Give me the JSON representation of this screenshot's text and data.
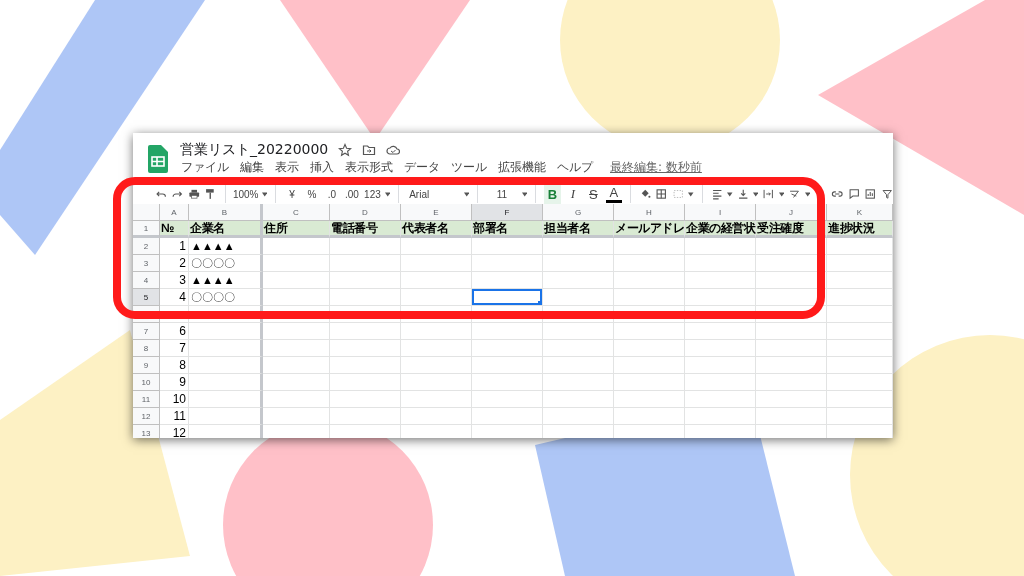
{
  "window": {
    "title": "営業リスト_20220000"
  },
  "menu": [
    "ファイル",
    "編集",
    "表示",
    "挿入",
    "表示形式",
    "データ",
    "ツール",
    "拡張機能",
    "ヘルプ"
  ],
  "last_edit": "最終編集: 数秒前",
  "toolbar": {
    "zoom": "100%",
    "currency": "¥",
    "percent": "%",
    "decrease_decimals": ".0",
    "increase_decimals": ".00",
    "number_format": "123",
    "font": "Arial",
    "font_size": "11",
    "bold": {
      "label": "B",
      "on": true
    },
    "italic": "I",
    "strikethrough": "S",
    "text_color": "A"
  },
  "columns": [
    {
      "letter": "A",
      "selected": false
    },
    {
      "letter": "B",
      "selected": false
    },
    {
      "letter": "C",
      "selected": false
    },
    {
      "letter": "D",
      "selected": false
    },
    {
      "letter": "E",
      "selected": false
    },
    {
      "letter": "F",
      "selected": true
    },
    {
      "letter": "G",
      "selected": false
    },
    {
      "letter": "H",
      "selected": false
    },
    {
      "letter": "I",
      "selected": false
    },
    {
      "letter": "J",
      "selected": false
    },
    {
      "letter": "K",
      "selected": false
    }
  ],
  "rows": [
    {
      "number": "1",
      "selected": false,
      "cells": [
        "№",
        "企業名",
        "住所",
        "電話番号",
        "代表者名",
        "部署名",
        "担当者名",
        "メールアドレ",
        "企業の経営状",
        "受注確度",
        "進捗状況"
      ]
    },
    {
      "number": "2",
      "selected": false,
      "cells": [
        "1",
        "▲▲▲▲"
      ]
    },
    {
      "number": "3",
      "selected": false,
      "cells": [
        "2",
        "〇〇〇〇"
      ]
    },
    {
      "number": "4",
      "selected": false,
      "cells": [
        "3",
        "▲▲▲▲"
      ]
    },
    {
      "number": "5",
      "selected": true,
      "cells": [
        "4",
        "〇〇〇〇"
      ]
    },
    {
      "selected": false,
      "cells": []
    },
    {
      "number": "7",
      "selected": false,
      "cells": [
        "6"
      ]
    },
    {
      "number": "8",
      "selected": false,
      "cells": [
        "7"
      ]
    },
    {
      "number": "9",
      "selected": false,
      "cells": [
        "8"
      ]
    },
    {
      "number": "10",
      "selected": false,
      "cells": [
        "9"
      ]
    },
    {
      "number": "11",
      "selected": false,
      "cells": [
        "10"
      ]
    },
    {
      "number": "12",
      "selected": false,
      "cells": [
        "11"
      ]
    },
    {
      "number": "13",
      "selected": false,
      "cells": [
        "12"
      ]
    }
  ]
}
